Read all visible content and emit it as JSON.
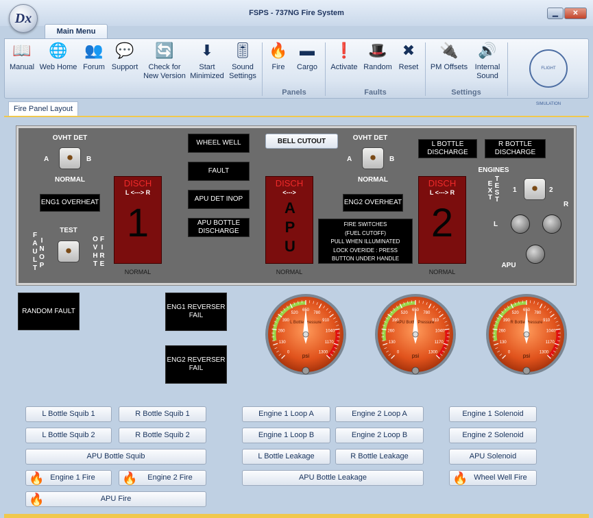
{
  "window": {
    "title": "FSPS - 737NG Fire System",
    "minimize_glyph": "▁",
    "close_glyph": "✕",
    "app_icon_text": "Dx"
  },
  "ribbon": {
    "tab": "Main Menu",
    "buttons": [
      {
        "label": "Manual",
        "icon": "manual-icon",
        "glyph": "📖"
      },
      {
        "label": "Web Home",
        "icon": "web-home-icon",
        "glyph": "🌐"
      },
      {
        "label": "Forum",
        "icon": "forum-icon",
        "glyph": "👥"
      },
      {
        "label": "Support",
        "icon": "support-icon",
        "glyph": "💬"
      },
      {
        "label": "Check for New Version",
        "icon": "update-icon",
        "glyph": "🔄"
      },
      {
        "label": "Start Minimized",
        "icon": "minimize-icon",
        "glyph": "⬇"
      },
      {
        "label": "Sound Settings",
        "icon": "sound-settings-icon",
        "glyph": "🎚"
      },
      {
        "label": "Fire",
        "icon": "fire-icon",
        "glyph": "🔥"
      },
      {
        "label": "Cargo",
        "icon": "cargo-icon",
        "glyph": "▬"
      },
      {
        "label": "Activate",
        "icon": "activate-icon",
        "glyph": "❗"
      },
      {
        "label": "Random",
        "icon": "random-icon",
        "glyph": "🎩"
      },
      {
        "label": "Reset",
        "icon": "reset-icon",
        "glyph": "✖"
      },
      {
        "label": "PM Offsets",
        "icon": "pm-offsets-icon",
        "glyph": "🔌"
      },
      {
        "label": "Internal Sound",
        "icon": "internal-sound-icon",
        "glyph": "🔊"
      }
    ],
    "groups": {
      "panels": "Panels",
      "faults": "Faults",
      "settings": "Settings"
    },
    "logo_text": "FLIGHT SIMULATION"
  },
  "doc_tab": "Fire Panel Layout",
  "panel": {
    "ovht_det_left": "OVHT DET",
    "ovht_det_right": "OVHT DET",
    "a": "A",
    "b": "B",
    "normal": "NORMAL",
    "eng1_overheat": "ENG1 OVERHEAT",
    "eng2_overheat": "ENG2 OVERHEAT",
    "test": "TEST",
    "fault_inop": [
      "F",
      "A",
      "U",
      "L",
      "T"
    ],
    "inop": [
      "I",
      "N",
      "O",
      "P"
    ],
    "ovht": [
      "O",
      "V",
      "H",
      "T"
    ],
    "fire": [
      "F",
      "I",
      "R",
      "E"
    ],
    "wheel_well": "WHEEL WELL",
    "fault": "FAULT",
    "apu_det_inop": "APU DET INOP",
    "apu_bottle_discharge": "APU BOTTLE DISCHARGE",
    "bell_cutout": "BELL CUTOUT",
    "l_bottle_discharge": "L BOTTLE DISCHARGE",
    "r_bottle_discharge": "R BOTTLE DISCHARGE",
    "engines": "ENGINES",
    "ext_test_ext": [
      "E",
      "X",
      "T"
    ],
    "ext_test_test": [
      "T",
      "E",
      "S",
      "T"
    ],
    "one": "1",
    "two": "2",
    "l": "L",
    "r": "R",
    "apu": "APU",
    "disch": "DISCH",
    "arrow": "L <---> R",
    "disch_apu_arrow": "<--->",
    "disch1": "1",
    "disch2": "2",
    "disch_apu": "APU",
    "fire_switches": [
      "FIRE SWITCHES",
      "(FUEL CUTOFF)",
      "PULL WHEN ILLUMINATED",
      "LOCK OVERIDE : PRESS",
      "BUTTON UNDER HANDLE"
    ],
    "switch_glyph": "⏺"
  },
  "faults": {
    "random": "RANDOM FAULT",
    "eng1_rev": "ENG1 REVERSER FAIL",
    "eng2_rev": "ENG2 REVERSER FAIL"
  },
  "gauges": [
    {
      "name": "L Bottle Pressure",
      "value": 650
    },
    {
      "name": "APU Bottle Pressure",
      "value": 650
    },
    {
      "name": "R Bottle Pressure",
      "value": 650
    }
  ],
  "gauge_ticks": [
    "0",
    "130",
    "260",
    "390",
    "520",
    "650",
    "780",
    "910",
    "1040",
    "1170",
    "1300"
  ],
  "gauge_unit": "psi",
  "buttons": {
    "l_bottle_squib_1": "L Bottle Squib 1",
    "r_bottle_squib_1": "R Bottle Squib 1",
    "l_bottle_squib_2": "L Bottle Squib 2",
    "r_bottle_squib_2": "R Bottle Squib 2",
    "apu_bottle_squib": "APU Bottle Squib",
    "engine_1_fire": "Engine 1 Fire",
    "engine_2_fire": "Engine 2 Fire",
    "apu_fire": "APU Fire",
    "engine_1_loop_a": "Engine 1 Loop A",
    "engine_2_loop_a": "Engine 2 Loop A",
    "engine_1_loop_b": "Engine 1 Loop B",
    "engine_2_loop_b": "Engine 2 Loop B",
    "l_bottle_leakage": "L Bottle Leakage",
    "r_bottle_leakage": "R Bottle Leakage",
    "apu_bottle_leakage": "APU Bottle Leakage",
    "engine_1_solenoid": "Engine 1 Solenoid",
    "engine_2_solenoid": "Engine 2 Solenoid",
    "apu_solenoid": "APU Solenoid",
    "wheel_well_fire": "Wheel Well Fire"
  },
  "fire_glyph": "🔥"
}
